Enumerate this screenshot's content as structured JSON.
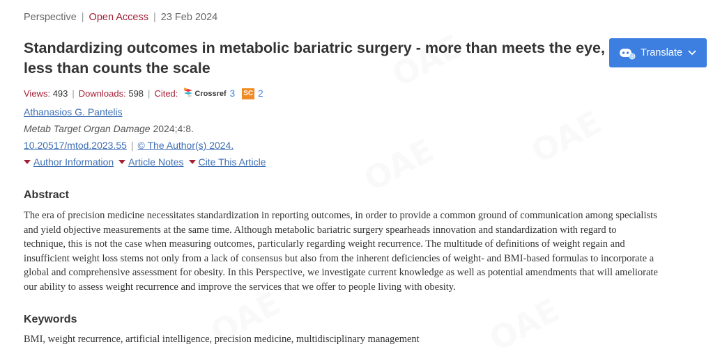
{
  "header": {
    "article_type": "Perspective",
    "access": "Open Access",
    "date": "23 Feb 2024"
  },
  "title": "Standardizing outcomes in metabolic bariatric surgery - more than meets the eye, less than counts the scale",
  "translate": {
    "label": "Translate"
  },
  "stats": {
    "views_label": "Views:",
    "views": "493",
    "downloads_label": "Downloads:",
    "downloads": "598",
    "cited_label": "Cited:",
    "crossref_label": "Crossref",
    "crossref_count": "3",
    "sc_badge": "SC",
    "sc_count": "2"
  },
  "author": "Athanasios G. Pantelis",
  "journal": {
    "name": "Metab Target Organ Damage",
    "citation": "2024;4:8."
  },
  "doi": "10.20517/mtod.2023.55",
  "copyright": "© The Author(s) 2024.",
  "toggles": [
    "Author Information",
    "Article Notes",
    "Cite This Article"
  ],
  "abstract": {
    "heading": "Abstract",
    "lines": [
      "The era of precision medicine necessitates standardization in reporting outcomes, in order to provide a common ground of communication among specialists",
      "and yield objective measurements at the same time. Although metabolic bariatric surgery spearheads innovation and standardization with regard to",
      "technique, this is not the case when measuring outcomes, particularly regarding weight recurrence. The multitude of definitions of weight regain and",
      "insufficient weight loss stems not only from a lack of consensus but also from the inherent deficiencies of weight- and BMI-based formulas to incorporate a",
      "global and comprehensive assessment for obesity. In this Perspective, we investigate current knowledge as well as potential amendments that will ameliorate",
      "our ability to assess weight recurrence and improve the services that we offer to people living with obesity."
    ]
  },
  "keywords": {
    "heading": "Keywords",
    "text": "BMI, weight recurrence, artificial intelligence, precision medicine, multidisciplinary management"
  },
  "colors": {
    "accent_red": "#a31f34",
    "link_blue": "#3d6eb4",
    "button_blue": "#3d7fe0",
    "sc_orange": "#f08a24"
  }
}
